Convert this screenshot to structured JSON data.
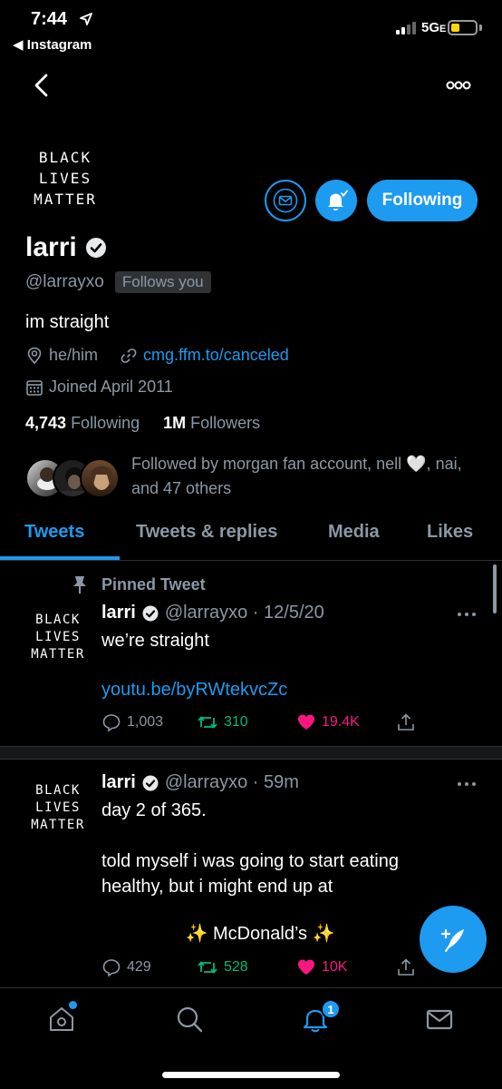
{
  "status_bar": {
    "time": "7:44",
    "back_app": "◀ Instagram",
    "network": "5G",
    "network_suffix": "E"
  },
  "profile": {
    "avatar_text": [
      "BLACK",
      "LIVES",
      "MATTER"
    ],
    "following_label": "Following",
    "display_name": "larri",
    "handle": "@larrayxo",
    "follows_you": "Follows you",
    "bio": "im straight",
    "pronouns": "he/him",
    "link": "cmg.ffm.to/canceled",
    "joined": "Joined April 2011",
    "following_count": "4,743",
    "following_label_text": "Following",
    "followers_count": "1M",
    "followers_label_text": "Followers",
    "followed_by": "Followed by morgan fan account, nell 🤍, nai, and 47 others"
  },
  "tabs": [
    {
      "label": "Tweets",
      "active": true
    },
    {
      "label": "Tweets & replies",
      "active": false
    },
    {
      "label": "Media",
      "active": false
    },
    {
      "label": "Likes",
      "active": false
    }
  ],
  "tweets": [
    {
      "pinned_label": "Pinned Tweet",
      "name": "larri",
      "handle_time": "@larrayxo · 12/5/20",
      "text": "we’re straight",
      "link": "youtu.be/byRWtekvcZc",
      "replies": "1,003",
      "retweets": "310",
      "likes": "19.4K"
    },
    {
      "name": "larri",
      "handle_time": "@larrayxo · 59m",
      "text_line1": "day 2 of 365.",
      "text_line2": "told myself i was going to start eating",
      "text_line3": "healthy, but i might end up at",
      "mcd": "McDonald’s",
      "sparkle": "✨",
      "replies": "429",
      "retweets": "528",
      "likes": "10K"
    }
  ],
  "bottom_nav": {
    "notification_count": "1"
  },
  "colors": {
    "accent": "#1d9bf0",
    "retweet": "#00ba7c",
    "like": "#f91880",
    "muted": "#8b98a5",
    "background": "#000000"
  },
  "icons": [
    "back-arrow-icon",
    "more-icon",
    "mail-icon",
    "bell-icon",
    "verified-icon",
    "location-icon",
    "link-icon",
    "calendar-icon",
    "pin-icon",
    "reply-icon",
    "retweet-icon",
    "heart-icon",
    "share-icon",
    "compose-icon",
    "home-icon",
    "search-icon",
    "notifications-icon",
    "messages-icon"
  ]
}
